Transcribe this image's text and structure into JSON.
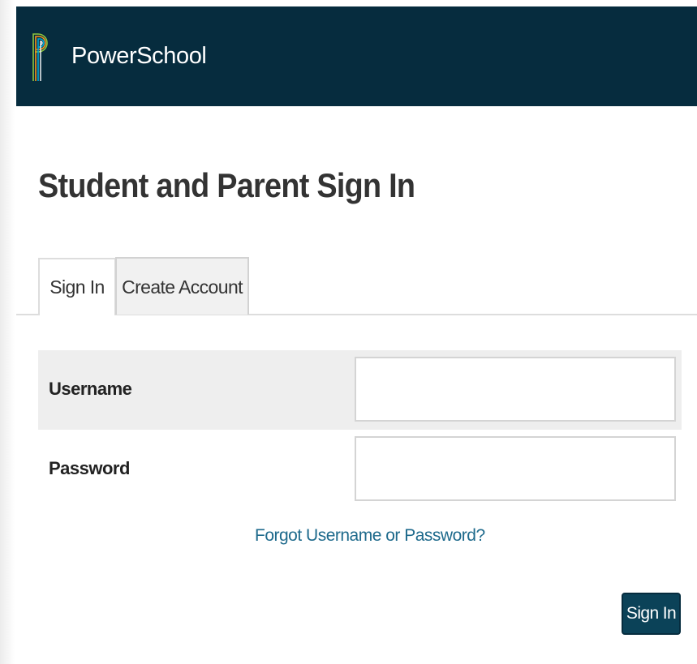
{
  "header": {
    "brand": "PowerSchool",
    "logo_icon": "powerschool-logo-icon",
    "background_color": "#062c3e"
  },
  "main": {
    "title": "Student and Parent Sign In",
    "tabs": [
      {
        "label": "Sign In",
        "active": true
      },
      {
        "label": "Create Account",
        "active": false
      }
    ],
    "form": {
      "username_label": "Username",
      "username_value": "",
      "password_label": "Password",
      "password_value": "",
      "forgot_link": "Forgot Username or Password?",
      "submit_label": "Sign In"
    }
  },
  "colors": {
    "accent": "#0b4258",
    "link": "#1e6a8c",
    "logo_stripes": [
      "#8dc63f",
      "#f7941d",
      "#00a6d6",
      "#ffffff"
    ]
  }
}
